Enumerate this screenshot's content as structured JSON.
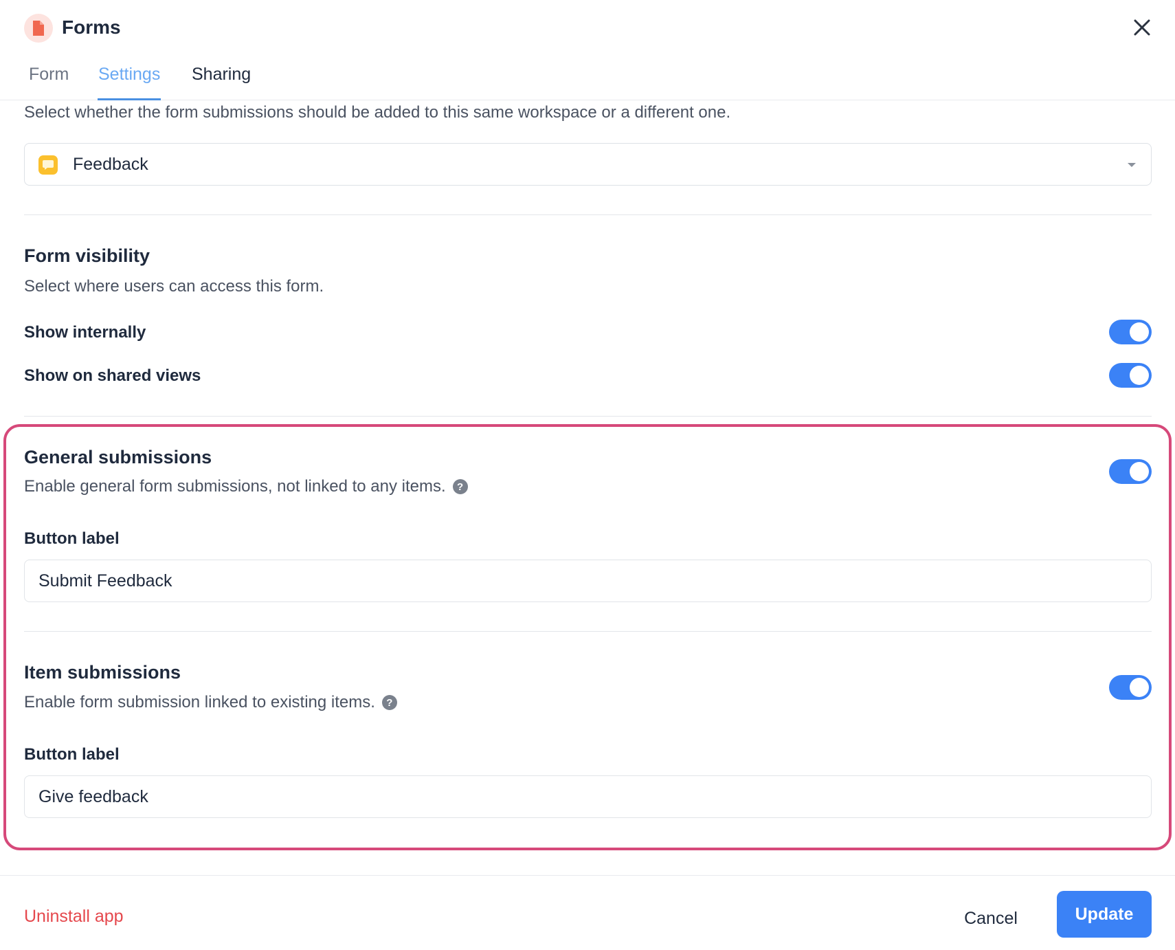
{
  "header": {
    "title": "Forms",
    "logo_icon": "document-icon",
    "close_icon": "close-icon",
    "tabs": [
      {
        "label": "Form",
        "active": false
      },
      {
        "label": "Settings",
        "active": true
      },
      {
        "label": "Sharing",
        "active": false
      }
    ]
  },
  "workspace": {
    "description": "Select whether the form submissions should be added to this same workspace or a different one.",
    "selected": "Feedback",
    "selected_icon": "chat-bubble-icon"
  },
  "visibility": {
    "title": "Form visibility",
    "description": "Select where users can access this form.",
    "options": [
      {
        "label": "Show internally",
        "enabled": true
      },
      {
        "label": "Show on shared views",
        "enabled": true
      }
    ]
  },
  "general_submissions": {
    "title": "General submissions",
    "description": "Enable general form submissions, not linked to any items.",
    "enabled": true,
    "button_label_title": "Button label",
    "button_label_value": "Submit Feedback"
  },
  "item_submissions": {
    "title": "Item submissions",
    "description": "Enable form submission linked to existing items.",
    "enabled": true,
    "button_label_title": "Button label",
    "button_label_value": "Give feedback"
  },
  "footer": {
    "uninstall_label": "Uninstall app",
    "cancel_label": "Cancel",
    "update_label": "Update"
  },
  "colors": {
    "accent": "#3b82f6",
    "danger": "#e5484d",
    "highlight": "#d6497a"
  }
}
